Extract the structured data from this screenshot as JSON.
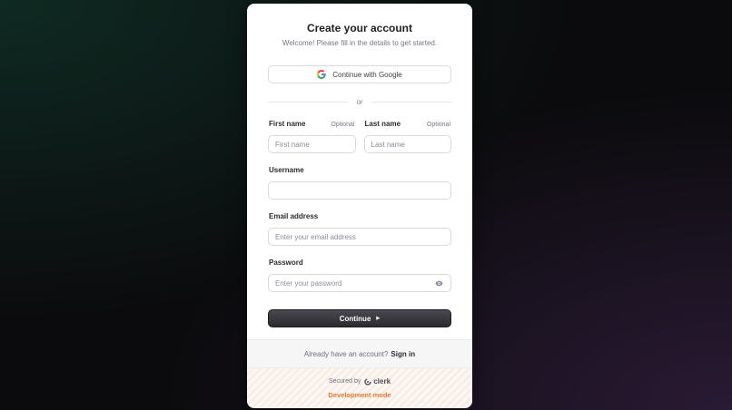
{
  "title": "Create your account",
  "subtitle": "Welcome! Please fill in the details to get started.",
  "google_button": {
    "label": "Continue with Google",
    "icon": "google-icon"
  },
  "divider_text": "or",
  "first_name": {
    "label": "First name",
    "optional": "Optional",
    "placeholder": "First name",
    "value": ""
  },
  "last_name": {
    "label": "Last name",
    "optional": "Optional",
    "placeholder": "Last name",
    "value": ""
  },
  "username": {
    "label": "Username",
    "placeholder": "",
    "value": ""
  },
  "email": {
    "label": "Email address",
    "placeholder": "Enter your email address",
    "value": ""
  },
  "password": {
    "label": "Password",
    "placeholder": "Enter your password",
    "value": "",
    "toggle_icon": "eye-icon"
  },
  "continue_button": {
    "label": "Continue",
    "icon": "arrow-right-icon"
  },
  "signin_prompt": {
    "text": "Already have an account?",
    "link": "Sign in"
  },
  "footer": {
    "secured_by": "Secured by",
    "brand": "clerk",
    "dev_mode": "Development mode"
  },
  "colors": {
    "accent_dark": "#2f2f34",
    "dev_mode": "#e8772e"
  }
}
